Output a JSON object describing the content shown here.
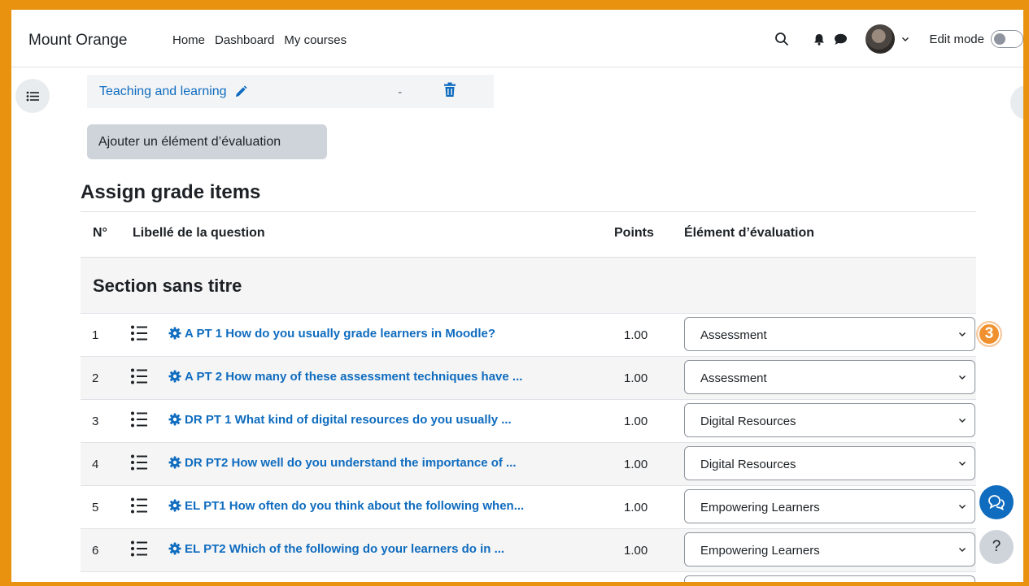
{
  "navbar": {
    "brand": "Mount Orange",
    "links": [
      "Home",
      "Dashboard",
      "My courses"
    ],
    "edit_mode_label": "Edit mode"
  },
  "category": {
    "name": "Teaching and learning",
    "dash": "-"
  },
  "add_button_label": "Ajouter un élément d’évaluation",
  "heading": "Assign grade items",
  "table": {
    "headers": {
      "num": "N°",
      "question": "Libellé de la question",
      "points": "Points",
      "grade_item": "Élément d’évaluation"
    },
    "section_title": "Section sans titre",
    "rows": [
      {
        "num": "1",
        "question": "A PT 1 How do you usually grade learners in Moodle?",
        "points": "1.00",
        "grade_item": "Assessment"
      },
      {
        "num": "2",
        "question": "A PT 2 How many of these assessment techniques have ...",
        "points": "1.00",
        "grade_item": "Assessment"
      },
      {
        "num": "3",
        "question": "DR PT 1 What kind of digital resources do you usually ...",
        "points": "1.00",
        "grade_item": "Digital Resources"
      },
      {
        "num": "4",
        "question": "DR PT2 How well do you understand the importance of ...",
        "points": "1.00",
        "grade_item": "Digital Resources"
      },
      {
        "num": "5",
        "question": "EL PT1 How often do you think about the following when...",
        "points": "1.00",
        "grade_item": "Empowering Learners"
      },
      {
        "num": "6",
        "question": "EL PT2 Which of the following do your learners do in ...",
        "points": "1.00",
        "grade_item": "Empowering Learners"
      }
    ]
  },
  "badge": "3",
  "help_label": "?",
  "colors": {
    "accent_link": "#0f6cbf",
    "frame_border": "#e8920f",
    "badge": "#f0902e"
  }
}
